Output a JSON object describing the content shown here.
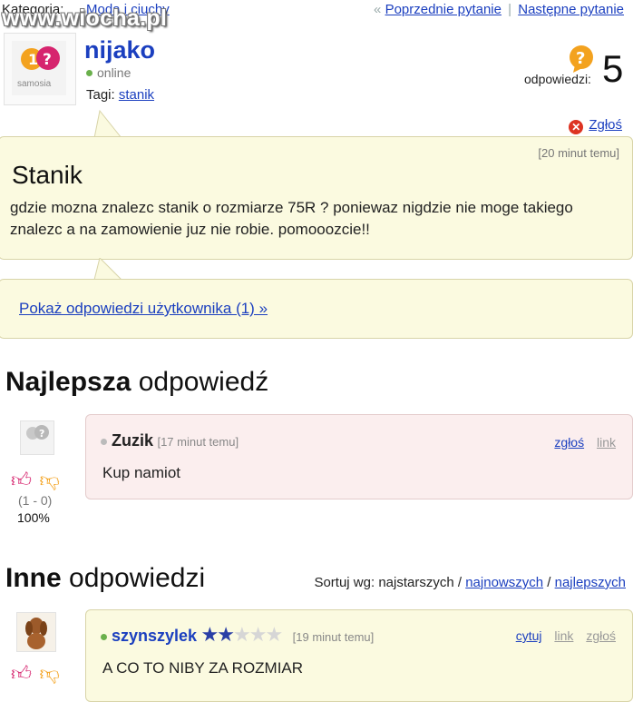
{
  "top": {
    "category_label": "Kategoria:",
    "category_link": "Moda i ciuchy",
    "watermark": "www.wiocha.pl",
    "nav_prev": "Poprzednie pytanie",
    "nav_next": "Następne pytanie",
    "nav_quote": "«",
    "nav_sep": "|"
  },
  "user": {
    "name": "nijako",
    "status": "online",
    "tags_label": "Tagi:",
    "tag": "stanik",
    "avatar_text": "samosia"
  },
  "answers": {
    "label": "odpowiedzi:",
    "count": "5"
  },
  "report": "Zgłoś",
  "question": {
    "time": "[20 minut temu]",
    "title": "Stanik",
    "body": "gdzie mozna znalezc stanik o rozmiarze 75R ? poniewaz nigdzie nie moge takiego znalezc a na zamowienie juz nie robie. pomooozcie!!"
  },
  "show_user_answers": "Pokaż odpowiedzi użytkownika (1) »",
  "best": {
    "heading_bold": "Najlepsza",
    "heading_rest": "odpowiedź",
    "votes": "(1 - 0)",
    "percent": "100%",
    "user": "Zuzik",
    "time": "[17 minut temu]",
    "report": "zgłoś",
    "link": "link",
    "text": "Kup namiot"
  },
  "other": {
    "heading_bold": "Inne",
    "heading_rest": "odpowiedzi",
    "sort_label": "Sortuj wg:",
    "sort_current": "najstarszych",
    "sort_sep": "/",
    "sort_newest": "najnowszych",
    "sort_best": "najlepszych",
    "answer": {
      "user": "szynszylek",
      "stars_on": 2,
      "stars_total": 5,
      "time": "[19 minut temu]",
      "quote": "cytuj",
      "link": "link",
      "report": "zgłoś",
      "text": "A CO TO NIBY ZA ROZMIAR"
    }
  },
  "colors": {
    "link": "#1b3fbf",
    "bubble_yellow": "#fbfae0",
    "bubble_pink": "#fbeeee"
  }
}
